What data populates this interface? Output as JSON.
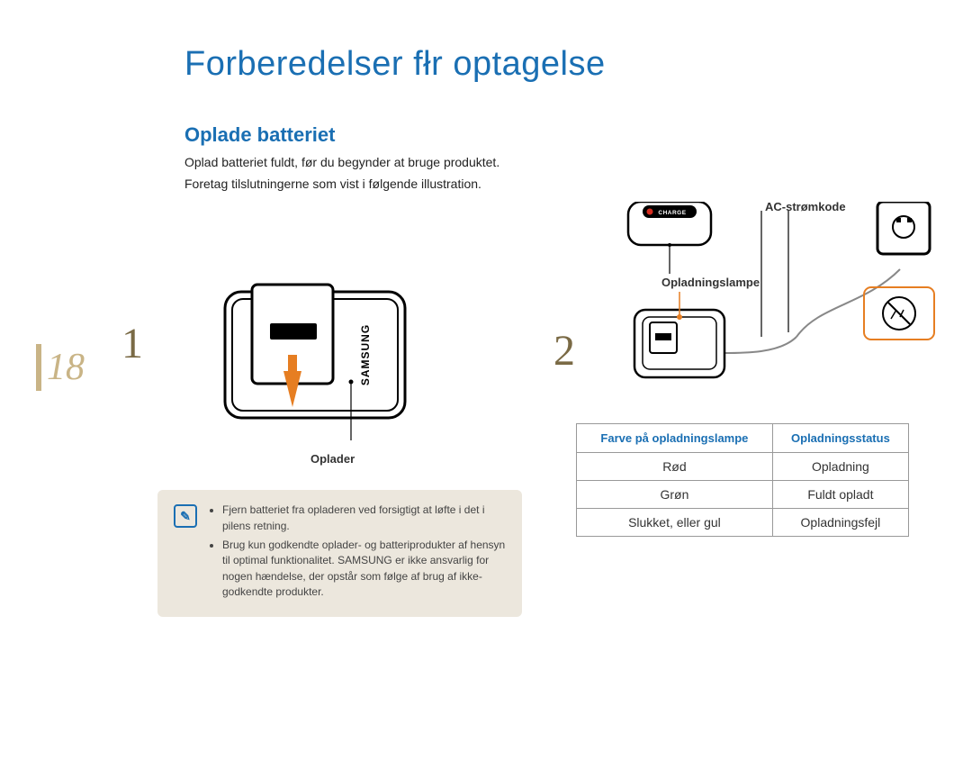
{
  "page_title": "Forberedelser fłr optagelse",
  "section_title": "Oplade batteriet",
  "intro_1": "Oplad batteriet fuldt, før du begynder at bruge produktet.",
  "intro_2": "Foretag tilslutningerne som vist i følgende illustration.",
  "page_number": "18",
  "steps": {
    "one": "1",
    "two": "2"
  },
  "labels": {
    "charger": "Oplader",
    "charge_text": "CHARGE",
    "ac_power": "AC-strømkode",
    "charging_lamp": "Opladningslampe",
    "brand": "SAMSUNG"
  },
  "notes": {
    "items": [
      "Fjern batteriet fra opladeren ved forsigtigt at løfte i det i pilens retning.",
      "Brug kun godkendte oplader- og batteriprodukter af hensyn til optimal funktionalitet. SAMSUNG er ikke ansvarlig for nogen hændelse, der opstår som følge af brug af ikke-godkendte produkter."
    ]
  },
  "table": {
    "header_left": "Farve på opladningslampe",
    "header_right": "Opladningsstatus",
    "rows": [
      {
        "color": "Rød",
        "status": "Opladning"
      },
      {
        "color": "Grøn",
        "status": "Fuldt opladt"
      },
      {
        "color": "Slukket, eller gul",
        "status": "Opladningsfejl"
      }
    ]
  }
}
